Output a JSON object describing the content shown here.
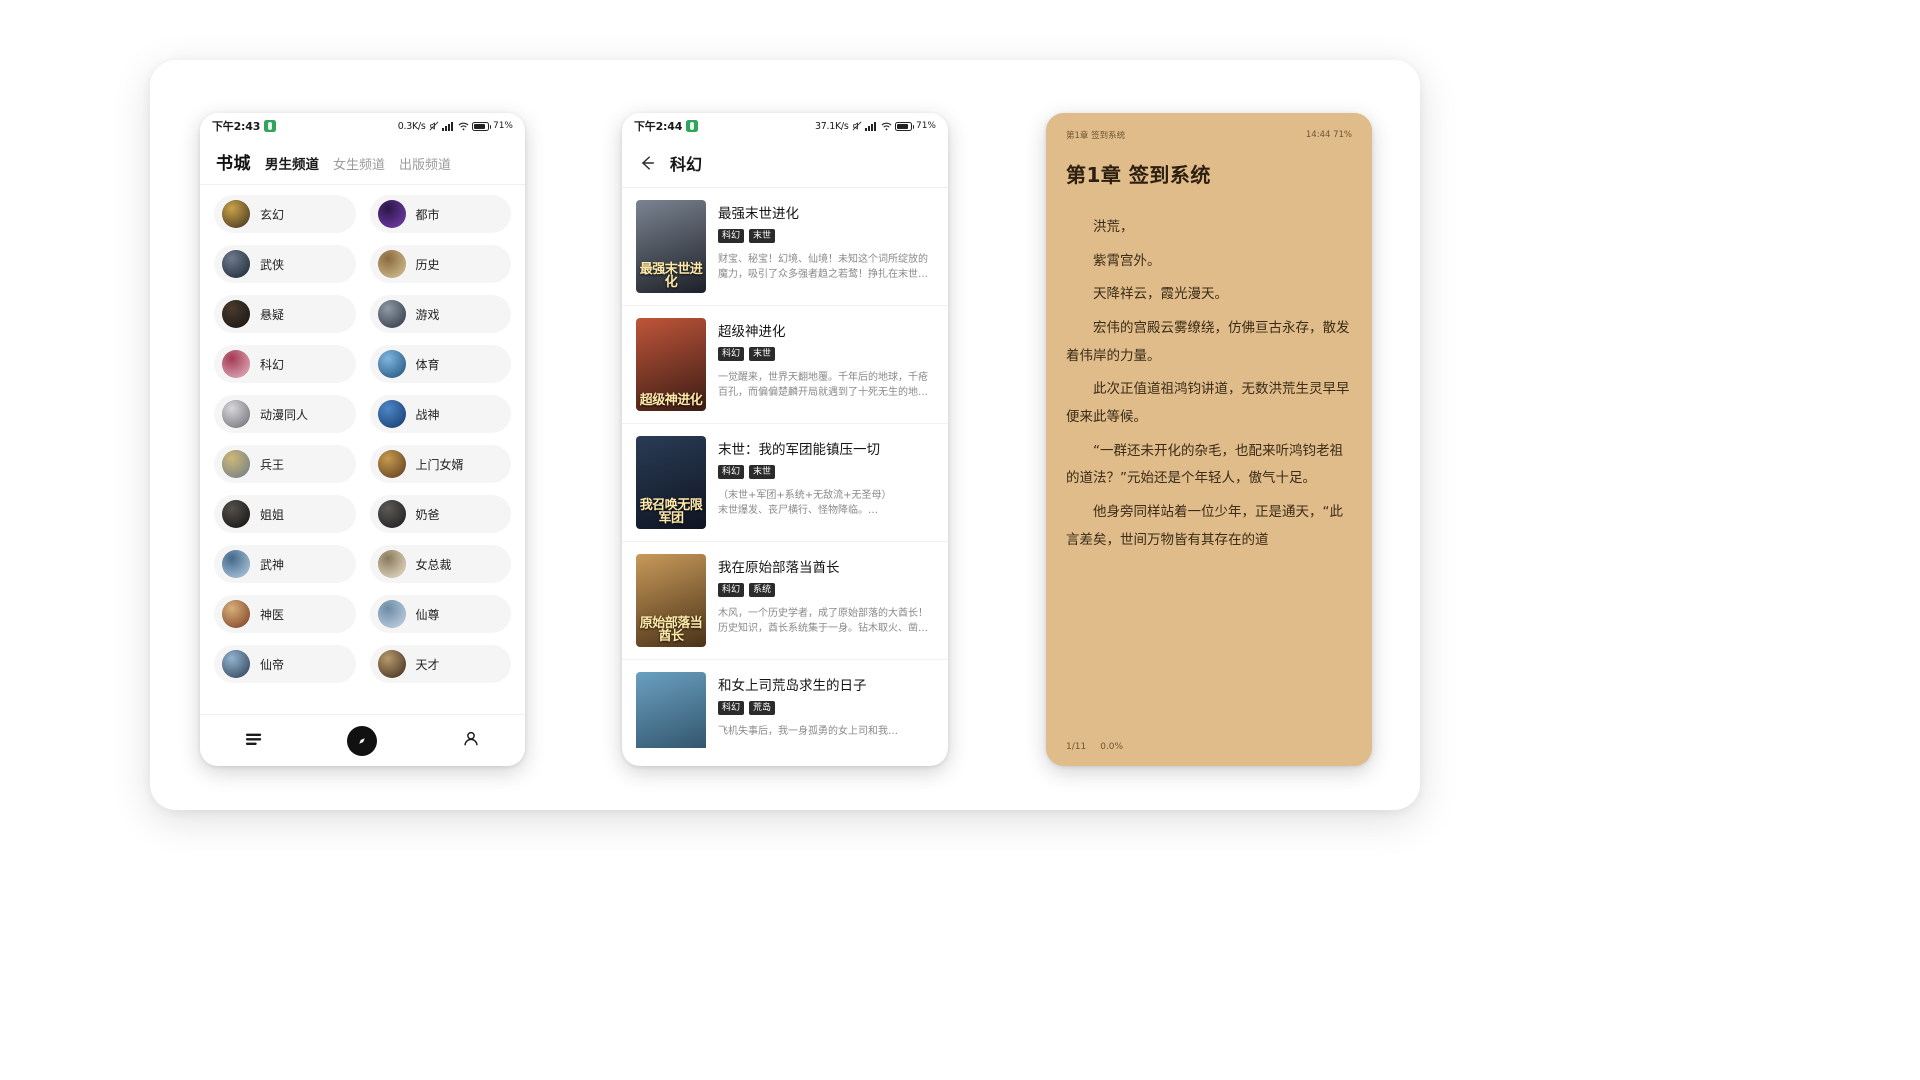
{
  "phone1": {
    "status": {
      "time": "下午2:43",
      "speed": "0.3K/s",
      "battery_pct": "71%",
      "app_icon": "app-icon",
      "mute_icon": "mute-icon",
      "signal_icon": "signal-icon",
      "wifi_icon": "wifi-icon",
      "battery_icon": "battery-icon"
    },
    "header": {
      "brand": "书城",
      "tabs": [
        {
          "label": "男生频道",
          "active": true
        },
        {
          "label": "女生频道",
          "active": false
        },
        {
          "label": "出版频道",
          "active": false
        }
      ]
    },
    "categories": [
      {
        "label": "玄幻",
        "c1": "#3c2f1e",
        "c2": "#caa24a"
      },
      {
        "label": "都市",
        "c1": "#7a3fb5",
        "c2": "#2b1746"
      },
      {
        "label": "武侠",
        "c1": "#1b2433",
        "c2": "#6d7b8c"
      },
      {
        "label": "历史",
        "c1": "#d9c79a",
        "c2": "#8a6a3c"
      },
      {
        "label": "悬疑",
        "c1": "#141414",
        "c2": "#4a3a2c"
      },
      {
        "label": "游戏",
        "c1": "#2c3440",
        "c2": "#8e9aa6"
      },
      {
        "label": "科幻",
        "c1": "#e8b9c8",
        "c2": "#a33a52"
      },
      {
        "label": "体育",
        "c1": "#1d4f7a",
        "c2": "#7fb6e0"
      },
      {
        "label": "动漫同人",
        "c1": "#6a6a72",
        "c2": "#d8d8dc"
      },
      {
        "label": "战神",
        "c1": "#123a6b",
        "c2": "#4f86c6"
      },
      {
        "label": "兵王",
        "c1": "#6b7a86",
        "c2": "#cdb879"
      },
      {
        "label": "上门女婿",
        "c1": "#5c3a1c",
        "c2": "#c79a4e"
      },
      {
        "label": "姐姐",
        "c1": "#111111",
        "c2": "#55504c"
      },
      {
        "label": "奶爸",
        "c1": "#1a1a1c",
        "c2": "#5d5a55"
      },
      {
        "label": "武神",
        "c1": "#b9d2e4",
        "c2": "#43688c"
      },
      {
        "label": "女总裁",
        "c1": "#efe4cf",
        "c2": "#8a7a5c"
      },
      {
        "label": "神医",
        "c1": "#7a3a22",
        "c2": "#d8b07a"
      },
      {
        "label": "仙尊",
        "c1": "#c8d8e6",
        "c2": "#6d8ba6"
      },
      {
        "label": "仙帝",
        "c1": "#2a3c52",
        "c2": "#93b4cf"
      },
      {
        "label": "天才",
        "c1": "#3a2a1c",
        "c2": "#b79a6c"
      }
    ],
    "tabbar": [
      {
        "icon": "bookshelf-icon",
        "name": "tab-bookshelf"
      },
      {
        "icon": "compass-icon",
        "name": "tab-discover"
      },
      {
        "icon": "person-icon",
        "name": "tab-profile"
      }
    ]
  },
  "phone2": {
    "status": {
      "time": "下午2:44",
      "speed": "37.1K/s",
      "battery_pct": "71%"
    },
    "header": {
      "back_icon": "back-arrow-icon",
      "title": "科幻"
    },
    "books": [
      {
        "title": "最强末世进化",
        "tags": [
          "科幻",
          "末世"
        ],
        "desc": "财宝、秘宝！幻境、仙境！未知这个词所绽放的魔力，吸引了众多强者趋之若鹜！挣扎在末世中的…",
        "cover_text": "最强末世进化",
        "c1": "#7a8490",
        "c2": "#1d2028"
      },
      {
        "title": "超级神进化",
        "tags": [
          "科幻",
          "末世"
        ],
        "desc": "一觉醒来，世界天翻地覆。千年后的地球，千疮百孔，而偏偏楚麟开局就遇到了十死无生的地狱…",
        "cover_text": "超级神进化",
        "c1": "#c0553a",
        "c2": "#3a1c14"
      },
      {
        "title": "末世：我的军团能镇压一切",
        "tags": [
          "科幻",
          "末世"
        ],
        "desc": "（末世+军团+系统+无敌流+无圣母）\n    末世爆发、丧尸横行、怪物降临。…",
        "cover_text": "我召唤无限军团",
        "c1": "#2a3c55",
        "c2": "#0e1422"
      },
      {
        "title": "我在原始部落当酋长",
        "tags": [
          "科幻",
          "系统"
        ],
        "desc": "木风，一个历史学者，成了原始部落的大酋长！历史知识，酋长系统集于一身。钻木取火、凿冰捕…",
        "cover_text": "原始部落当酋长",
        "c1": "#c89a5a",
        "c2": "#4a3218"
      },
      {
        "title": "和女上司荒岛求生的日子",
        "tags": [
          "科幻",
          "荒岛"
        ],
        "desc": "飞机失事后，我一身孤勇的女上司和我…",
        "cover_text": "",
        "c1": "#6aa0c0",
        "c2": "#2a4a60"
      }
    ]
  },
  "phone3": {
    "header": {
      "chapter_label": "第1章 签到系统",
      "clock": "14:44",
      "battery_pct": "71%"
    },
    "chapter_title": "第1章 签到系统",
    "paragraphs": [
      "洪荒，",
      "紫霄宫外。",
      "天降祥云，霞光漫天。",
      "宏伟的宫殿云雾缭绕，仿佛亘古永存，散发着伟岸的力量。",
      "此次正值道祖鸿钧讲道，无数洪荒生灵早早便来此等候。",
      "“一群还未开化的杂毛，也配来听鸿钧老祖的道法？”元始还是个年轻人，傲气十足。",
      "他身旁同样站着一位少年，正是通天，“此言差矣，世间万物皆有其存在的道"
    ],
    "footer": {
      "page": "1/11",
      "progress": "0.0%"
    }
  }
}
